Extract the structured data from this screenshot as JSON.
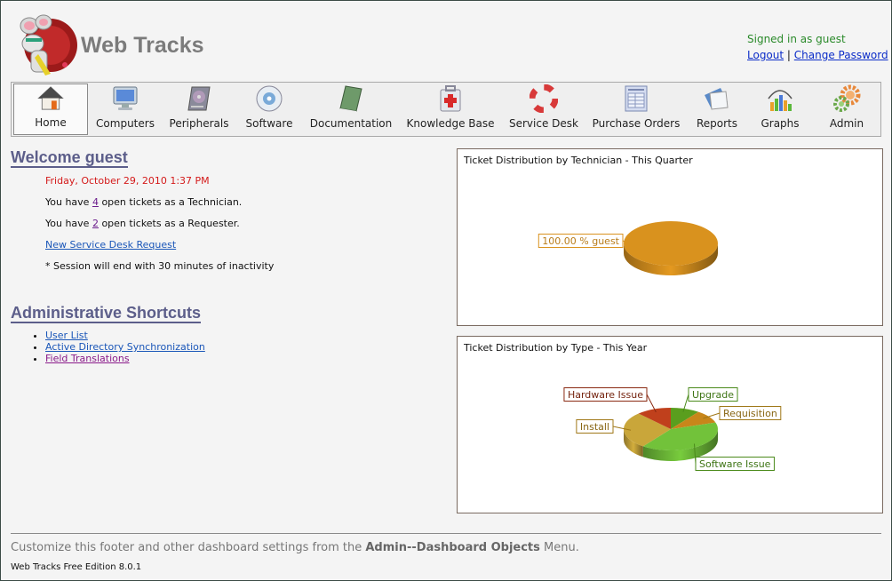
{
  "app": {
    "title": "Web Tracks"
  },
  "user": {
    "signed_in_text": "Signed in as guest",
    "logout": "Logout",
    "separator": "|",
    "change_password": "Change Password"
  },
  "nav": [
    {
      "label": "Home",
      "icon": "home-icon",
      "active": true
    },
    {
      "label": "Computers",
      "icon": "monitor-icon"
    },
    {
      "label": "Peripherals",
      "icon": "hard-drive-icon"
    },
    {
      "label": "Software",
      "icon": "cd-icon"
    },
    {
      "label": "Documentation",
      "icon": "book-icon"
    },
    {
      "label": "Knowledge Base",
      "icon": "first-aid-kit-icon"
    },
    {
      "label": "Service Desk",
      "icon": "lifebuoy-icon"
    },
    {
      "label": "Purchase Orders",
      "icon": "form-icon"
    },
    {
      "label": "Reports",
      "icon": "reports-icon"
    },
    {
      "label": "Graphs",
      "icon": "bar-graph-icon"
    },
    {
      "label": "Admin",
      "icon": "gears-icon"
    }
  ],
  "welcome": {
    "heading": "Welcome guest",
    "date": "Friday, October 29, 2010 1:37 PM",
    "tech_prefix": "You have ",
    "tech_count": "4",
    "tech_suffix": " open tickets as a Technician.",
    "req_prefix": "You have ",
    "req_count": "2",
    "req_suffix": " open tickets as a Requester.",
    "new_request": "New Service Desk Request",
    "session_note": "* Session will end with 30 minutes of inactivity"
  },
  "shortcuts": {
    "heading": "Administrative Shortcuts",
    "items": [
      "User List",
      "Active Directory Synchronization",
      "Field Translations"
    ]
  },
  "chart_data": [
    {
      "type": "pie",
      "title": "Ticket Distribution by Technician - This Quarter",
      "categories": [
        "guest"
      ],
      "values": [
        100.0
      ],
      "labels": [
        "100.00 % guest"
      ],
      "colors": [
        "#d9921e"
      ]
    },
    {
      "type": "pie",
      "title": "Ticket Distribution by Type - This Year",
      "categories": [
        "Upgrade",
        "Requisition",
        "Software Issue",
        "Install",
        "Hardware Issue"
      ],
      "values": [
        10,
        10,
        40,
        28,
        12
      ],
      "labels": [
        "Upgrade",
        "Requisition",
        "Software Issue",
        "Install",
        "Hardware Issue"
      ],
      "colors": [
        "#5a9e1e",
        "#c8861a",
        "#72c23a",
        "#c9a63a",
        "#c0401c"
      ],
      "label_colors": [
        "#4a8a1a",
        "#a07818",
        "#4a8a1a",
        "#a07818",
        "#8a2a12"
      ]
    }
  ],
  "footer": {
    "note_prefix": "Customize this footer and other dashboard settings from the ",
    "note_bold": "Admin--Dashboard Objects",
    "note_suffix": " Menu.",
    "edition": "Web Tracks Free Edition 8.0.1"
  }
}
